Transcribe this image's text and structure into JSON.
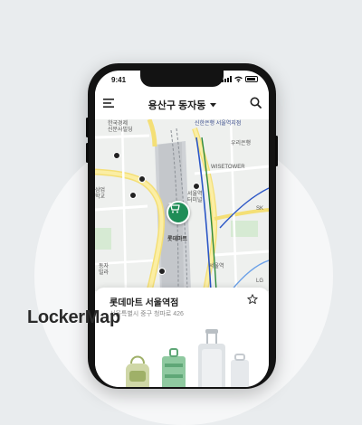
{
  "status_bar": {
    "time": "9:41"
  },
  "header": {
    "location_title": "용산구 동자동"
  },
  "map": {
    "labels": {
      "korea_times": "한국경제\n신문사빌딩",
      "shinhan": "신한은행 서울역지점",
      "woori": "우리은행",
      "wisetower": "WISETOWER",
      "sk": "SK",
      "seoul_station": "서울역\n터미널",
      "lotte_mart_pin": "롯데마트",
      "seoul_station_bottom": "서울역",
      "lg": "LG",
      "school": "삼업\n학교",
      "villa": "동자\n빌라"
    }
  },
  "store": {
    "name": "롯데마트 서울역점",
    "address": "서울특별시 중구 청파로 426"
  },
  "brand_text": "LockerMap",
  "colors": {
    "accent_green": "#1f8d57",
    "background": "#e9ecee"
  },
  "icons": {
    "menu": "menu-icon",
    "dropdown": "caret-down-icon",
    "search": "search-icon",
    "favorite": "star-outline-icon",
    "pin": "shopping-cart-icon"
  }
}
